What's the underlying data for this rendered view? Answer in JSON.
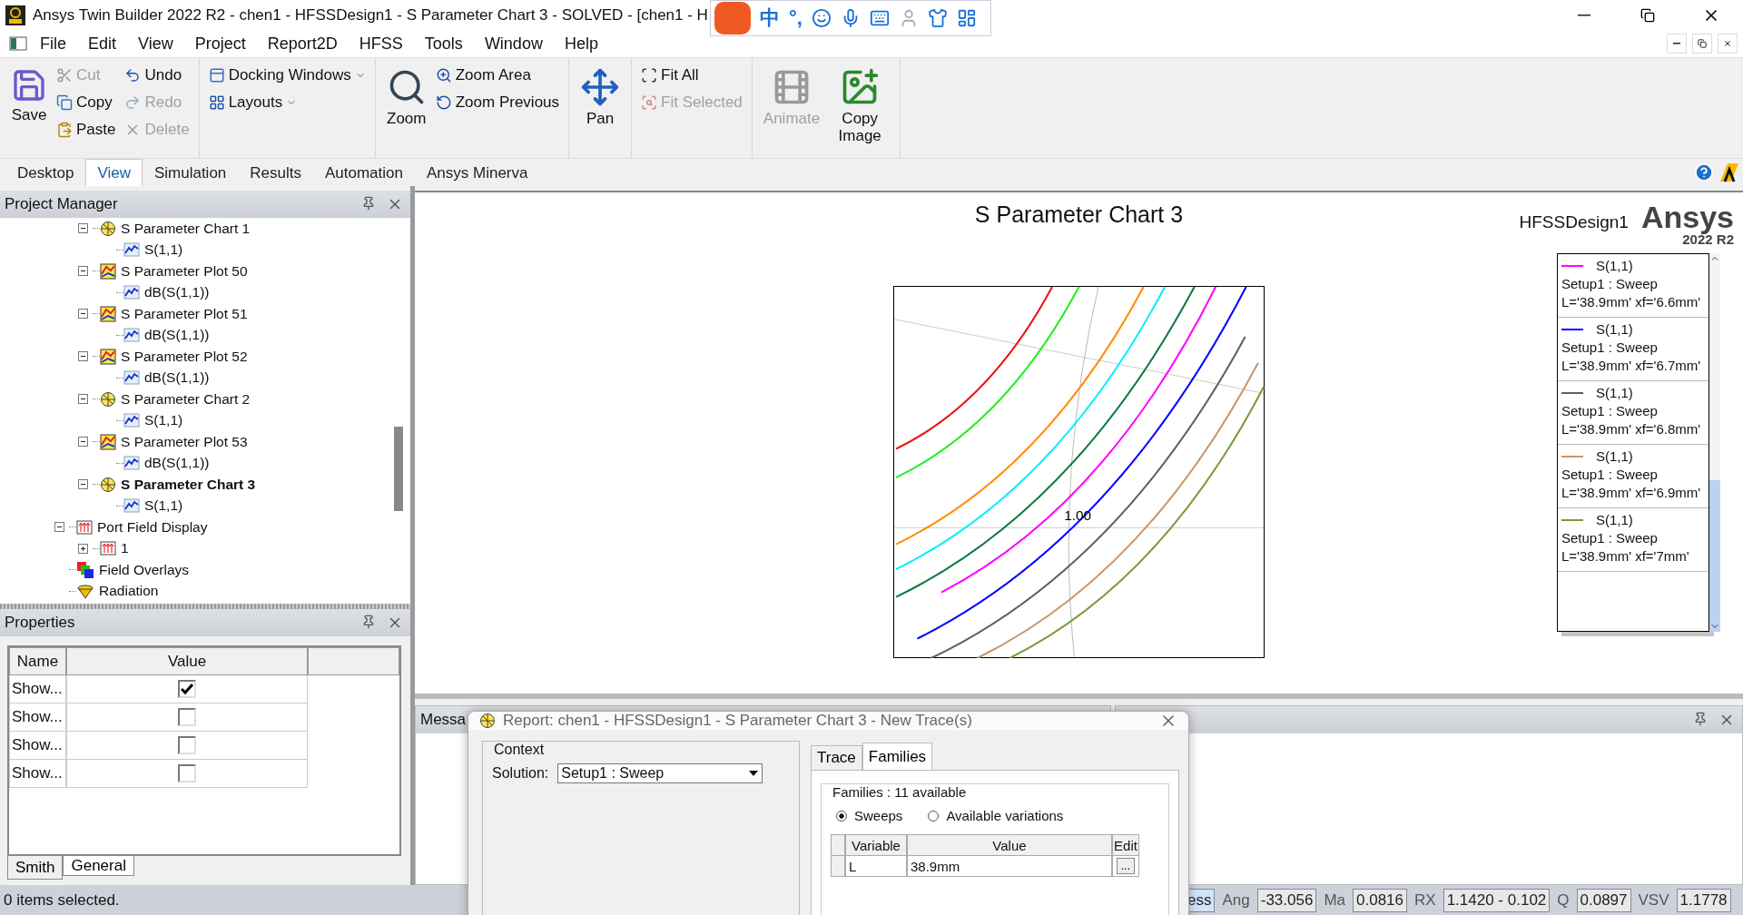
{
  "window": {
    "title": "Ansys Twin Builder 2022 R2 - chen1 - HFSSDesign1 - S Parameter Chart 3 - SOLVED - [chen1 - H"
  },
  "ime_toolbar": {
    "items": [
      "中",
      "°,"
    ]
  },
  "menu": [
    "File",
    "Edit",
    "View",
    "Project",
    "Report2D",
    "HFSS",
    "Tools",
    "Window",
    "Help"
  ],
  "ribbon": {
    "groups": [
      {
        "items": [
          {
            "kind": "large",
            "label": "Save",
            "disabled": false
          },
          {
            "kind": "small",
            "label": "Cut",
            "disabled": true
          },
          {
            "kind": "small",
            "label": "Copy",
            "disabled": false
          },
          {
            "kind": "small",
            "label": "Paste",
            "disabled": false
          },
          {
            "kind": "small",
            "label": "Undo",
            "disabled": false
          },
          {
            "kind": "small",
            "label": "Redo",
            "disabled": true
          },
          {
            "kind": "small",
            "label": "Delete",
            "disabled": true
          }
        ]
      },
      {
        "items": [
          {
            "kind": "small",
            "label": "Docking Windows",
            "disabled": false,
            "dropdown": true
          },
          {
            "kind": "small",
            "label": "Layouts",
            "disabled": false,
            "dropdown": true
          }
        ]
      },
      {
        "items": [
          {
            "kind": "large",
            "label": "Zoom",
            "disabled": false
          },
          {
            "kind": "small",
            "label": "Zoom Area",
            "disabled": false
          },
          {
            "kind": "small",
            "label": "Zoom Previous",
            "disabled": false
          }
        ]
      },
      {
        "items": [
          {
            "kind": "large",
            "label": "Pan",
            "disabled": false
          }
        ]
      },
      {
        "items": [
          {
            "kind": "small",
            "label": "Fit All",
            "disabled": false
          },
          {
            "kind": "small",
            "label": "Fit Selected",
            "disabled": true
          }
        ]
      },
      {
        "items": [
          {
            "kind": "large",
            "label": "Animate",
            "disabled": true
          },
          {
            "kind": "large",
            "label": "Copy Image",
            "disabled": false
          }
        ]
      }
    ]
  },
  "tabs": [
    {
      "label": "Desktop",
      "selected": false
    },
    {
      "label": "View",
      "selected": true
    },
    {
      "label": "Simulation",
      "selected": false
    },
    {
      "label": "Results",
      "selected": false
    },
    {
      "label": "Automation",
      "selected": false
    },
    {
      "label": "Ansys Minerva",
      "selected": false
    }
  ],
  "project_manager": {
    "title": "Project Manager",
    "tree": [
      {
        "kind": "hidden",
        "children": [
          {
            "kind": "hidden",
            "children": [
              {
                "kind": "chart",
                "label": "S Parameter Chart 1",
                "expanded": true,
                "selected": false,
                "children": [
                  {
                    "kind": "trace",
                    "label": "S(1,1)",
                    "selected": false
                  }
                ]
              },
              {
                "kind": "plot",
                "label": "S Parameter Plot 50",
                "expanded": true,
                "selected": false,
                "children": [
                  {
                    "kind": "trace",
                    "label": "dB(S(1,1))",
                    "selected": false
                  }
                ]
              },
              {
                "kind": "plot",
                "label": "S Parameter Plot 51",
                "expanded": true,
                "selected": false,
                "children": [
                  {
                    "kind": "trace",
                    "label": "dB(S(1,1))",
                    "selected": false
                  }
                ]
              },
              {
                "kind": "plot",
                "label": "S Parameter Plot 52",
                "expanded": true,
                "selected": false,
                "children": [
                  {
                    "kind": "trace",
                    "label": "dB(S(1,1))",
                    "selected": false
                  }
                ]
              },
              {
                "kind": "chart",
                "label": "S Parameter Chart 2",
                "expanded": true,
                "selected": false,
                "children": [
                  {
                    "kind": "trace",
                    "label": "S(1,1)",
                    "selected": false
                  }
                ]
              },
              {
                "kind": "plot",
                "label": "S Parameter Plot 53",
                "expanded": true,
                "selected": false,
                "children": [
                  {
                    "kind": "trace",
                    "label": "dB(S(1,1))",
                    "selected": false
                  }
                ]
              },
              {
                "kind": "chart",
                "label": "S Parameter Chart 3",
                "expanded": true,
                "selected": true,
                "children": [
                  {
                    "kind": "trace",
                    "label": "S(1,1)",
                    "selected": false
                  }
                ]
              }
            ]
          },
          {
            "kind": "port",
            "label": "Port Field Display",
            "expanded": true,
            "selected": false,
            "children": [
              {
                "kind": "port",
                "label": "1",
                "expanded": false,
                "selected": false
              }
            ]
          },
          {
            "kind": "overlay",
            "label": "Field Overlays",
            "selected": false
          },
          {
            "kind": "radiation",
            "label": "Radiation",
            "selected": false
          }
        ]
      }
    ]
  },
  "properties": {
    "title": "Properties",
    "columns": [
      "Name",
      "Value"
    ],
    "rows": [
      {
        "name": "Show...",
        "checked": true
      },
      {
        "name": "Show...",
        "checked": false
      },
      {
        "name": "Show...",
        "checked": false
      },
      {
        "name": "Show...",
        "checked": false
      }
    ],
    "tabs": [
      {
        "label": "Smith",
        "selected": true
      },
      {
        "label": "General",
        "selected": false
      }
    ]
  },
  "chart": {
    "title": "S Parameter Chart 3",
    "design": "HFSSDesign1",
    "logo": "Ansys",
    "version": "2022 R2",
    "grid_label": "1.00",
    "legend": [
      {
        "color": "#ff00ff",
        "trace": "S(1,1)",
        "solution": "Setup1 : Sweep",
        "variation": "L='38.9mm' xf='6.6mm'"
      },
      {
        "color": "#0000ff",
        "trace": "S(1,1)",
        "solution": "Setup1 : Sweep",
        "variation": "L='38.9mm' xf='6.7mm'"
      },
      {
        "color": "#606060",
        "trace": "S(1,1)",
        "solution": "Setup1 : Sweep",
        "variation": "L='38.9mm' xf='6.8mm'"
      },
      {
        "color": "#c8956a",
        "trace": "S(1,1)",
        "solution": "Setup1 : Sweep",
        "variation": "L='38.9mm' xf='6.9mm'"
      },
      {
        "color": "#7a9a3a",
        "trace": "S(1,1)",
        "solution": "Setup1 : Sweep",
        "variation": "L='38.9mm' xf='7mm'"
      }
    ]
  },
  "message_pane": {
    "title": "Messa"
  },
  "dialog": {
    "title": "Report: chen1 - HFSSDesign1 - S Parameter Chart 3 - New Trace(s)",
    "context": {
      "title": "Context",
      "solution_label": "Solution:",
      "solution": "Setup1 : Sweep"
    },
    "tabs": [
      {
        "label": "Trace",
        "selected": false
      },
      {
        "label": "Families",
        "selected": true
      }
    ],
    "families": {
      "title": "Families : 11 available",
      "options": [
        {
          "label": "Sweeps",
          "selected": true
        },
        {
          "label": "Available variations",
          "selected": false
        }
      ],
      "columns": [
        "Variable",
        "Value",
        "Edit"
      ],
      "rows": [
        {
          "variable": "L",
          "value": "38.9mm",
          "edit": "..."
        }
      ]
    }
  },
  "status_bar": {
    "text": "0 items selected.",
    "fields": [
      {
        "kind": "button",
        "text": "ess"
      },
      {
        "kind": "label",
        "text": "Ang"
      },
      {
        "kind": "value",
        "text": "-33.056"
      },
      {
        "kind": "label",
        "text": "Ma"
      },
      {
        "kind": "value",
        "text": "0.0816"
      },
      {
        "kind": "label",
        "text": "RX"
      },
      {
        "kind": "value",
        "text": "1.1420 - 0.102"
      },
      {
        "kind": "label",
        "text": "Q"
      },
      {
        "kind": "value",
        "text": "0.0897"
      },
      {
        "kind": "label",
        "text": "VSV"
      },
      {
        "kind": "value",
        "text": "1.1778"
      }
    ]
  }
}
